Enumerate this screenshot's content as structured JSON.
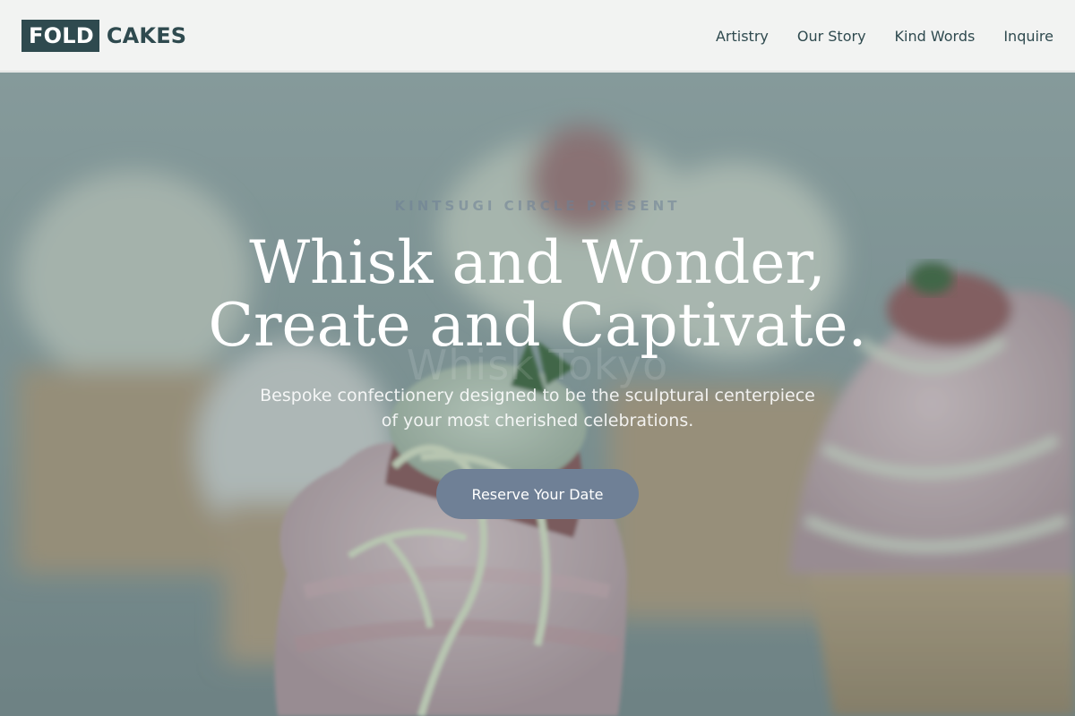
{
  "header": {
    "logo_box": "FOLD",
    "logo_text": "CAKES",
    "nav": [
      "Artistry",
      "Our Story",
      "Kind Words",
      "Inquire"
    ]
  },
  "hero": {
    "eyebrow": "KINTSUGI CIRCLE PRESENT",
    "ghost_text": "Whisk Tokyo",
    "headline_line1": "Whisk and Wonder,",
    "headline_line2": "Create and Captivate.",
    "subhead_line1": "Bespoke confectionery designed to be the sculptural centerpiece",
    "subhead_line2": "of your most cherished celebrations.",
    "cta_label": "Reserve Your Date"
  },
  "colors": {
    "brand": "#2f4a4f",
    "header_bg": "#f2f3f2",
    "cta": "#6f8096"
  }
}
